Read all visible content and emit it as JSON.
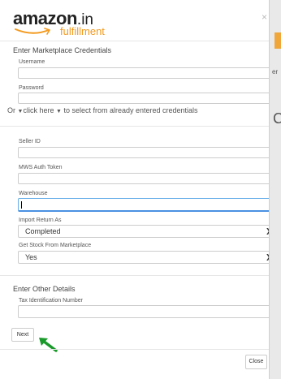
{
  "brand": {
    "amazon": "amazon",
    "in": ".in",
    "fulfillment": "fulfillment",
    "close_symbol": "×"
  },
  "background": {
    "side_text_1": "er",
    "side_text_2": "C"
  },
  "credentials": {
    "section_title": "Enter Marketplace Credentials",
    "username_label": "Username",
    "username_value": "",
    "password_label": "Password",
    "password_value": ""
  },
  "or_line": {
    "prefix": "Or",
    "link": "click here",
    "suffix": "to select from already entered credentials"
  },
  "seller": {
    "seller_id_label": "Seller ID",
    "mws_label": "MWS Auth Token",
    "warehouse_label": "Warehouse",
    "import_return_label": "Import Return As",
    "import_return_value": "Completed",
    "get_stock_label": "Get Stock From Marketplace",
    "get_stock_value": "Yes"
  },
  "other": {
    "section_title": "Enter Other Details",
    "tax_label": "Tax Identification Number"
  },
  "buttons": {
    "next": "Next",
    "close": "Close"
  },
  "colors": {
    "accent_orange": "#f39a1e",
    "arrow_green": "#1a9a2a",
    "focus_blue": "#4a90e2"
  }
}
